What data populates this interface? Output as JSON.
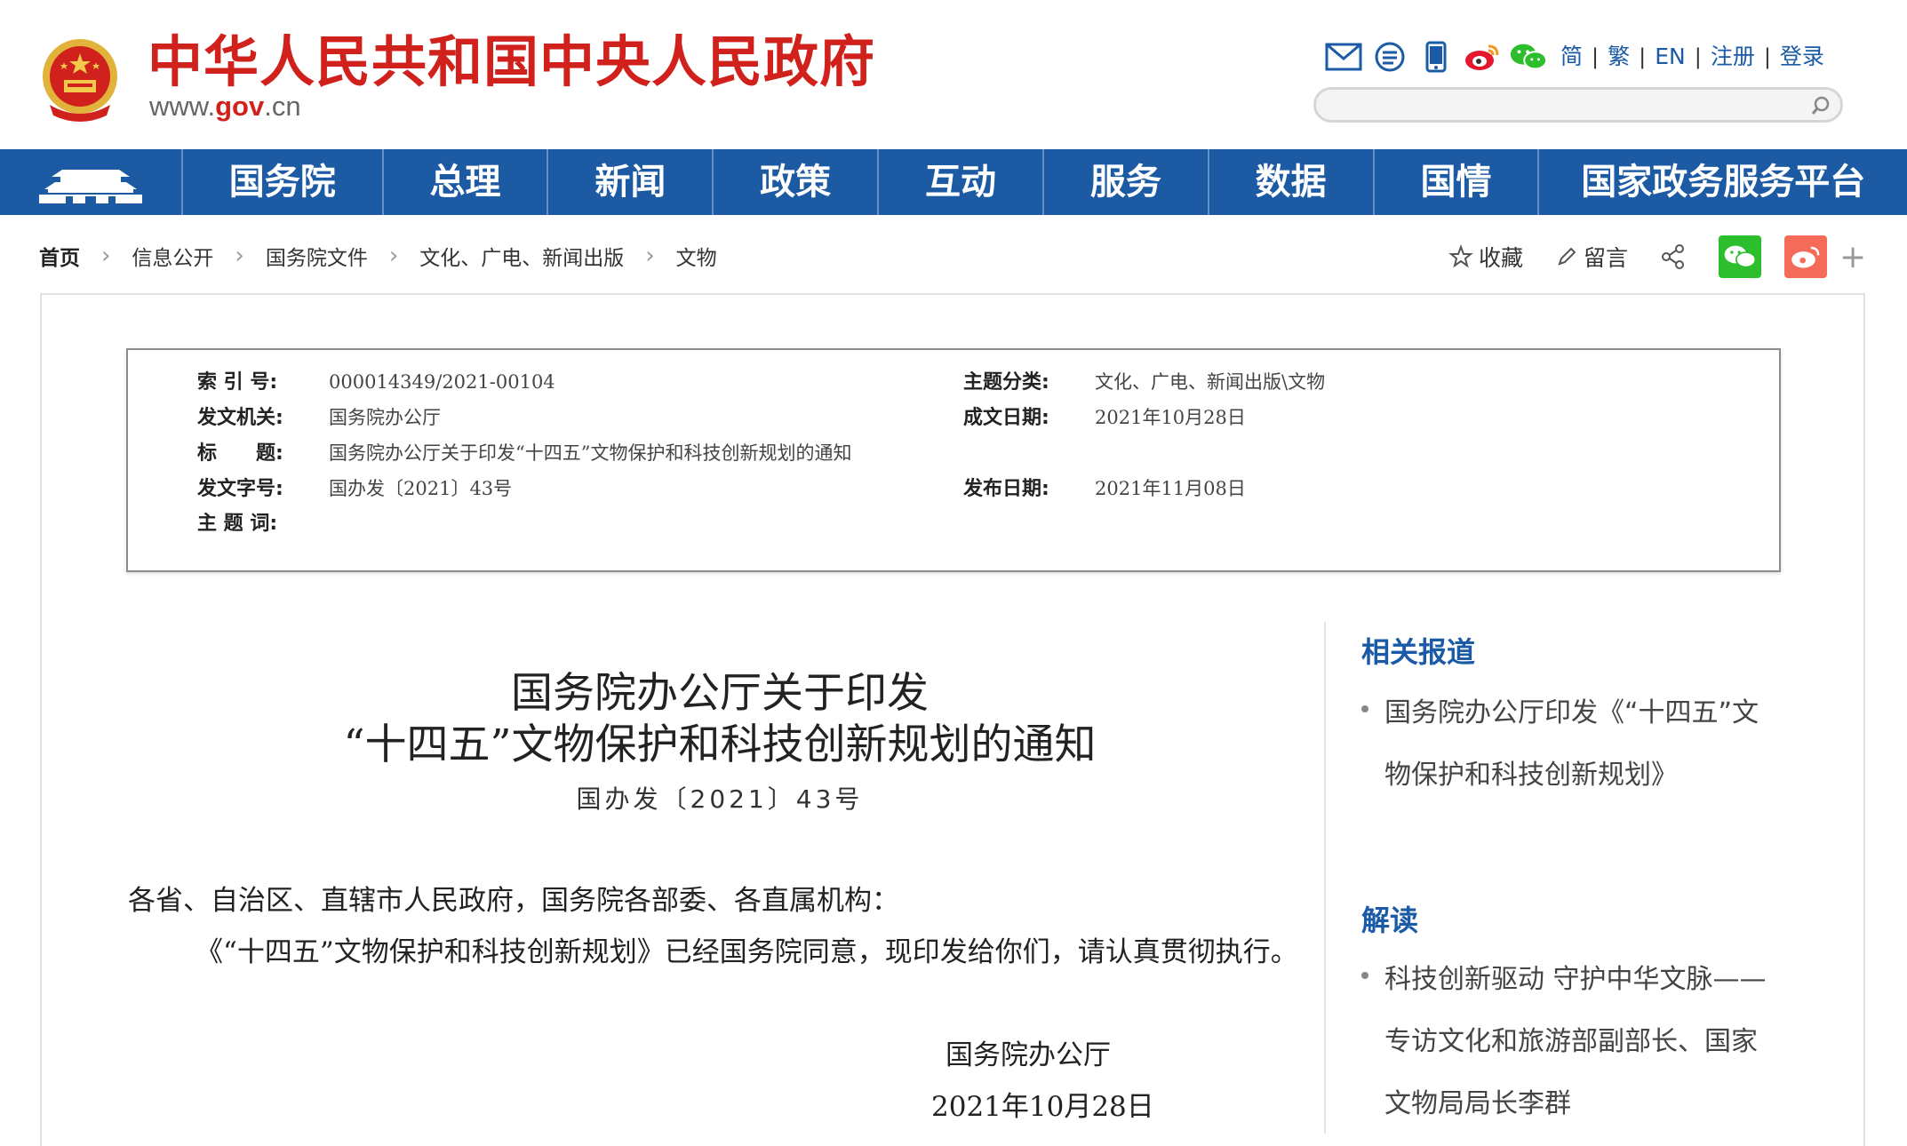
{
  "header": {
    "site_name": "中华人民共和国中央人民政府",
    "site_url_prefix": "www.",
    "site_url_domain": "gov",
    "site_url_suffix": ".cn",
    "links": [
      {
        "label": "简"
      },
      {
        "label": "繁"
      },
      {
        "label": "EN"
      },
      {
        "label": "注册"
      },
      {
        "label": "登录"
      }
    ],
    "search_placeholder": ""
  },
  "nav": {
    "items": [
      {
        "label": "国务院"
      },
      {
        "label": "总理"
      },
      {
        "label": "新闻"
      },
      {
        "label": "政策"
      },
      {
        "label": "互动"
      },
      {
        "label": "服务"
      },
      {
        "label": "数据"
      },
      {
        "label": "国情"
      },
      {
        "label": "国家政务服务平台"
      }
    ]
  },
  "breadcrumb": {
    "items": [
      {
        "label": "首页"
      },
      {
        "label": "信息公开"
      },
      {
        "label": "国务院文件"
      },
      {
        "label": "文化、广电、新闻出版"
      },
      {
        "label": "文物"
      }
    ]
  },
  "actions": {
    "favorite_label": "收藏",
    "comment_label": "留言"
  },
  "meta": {
    "index_label": "索 引 号:",
    "index_value": "000014349/2021-00104",
    "category_label": "主题分类:",
    "category_value": "文化、广电、新闻出版\\文物",
    "issuer_label": "发文机关:",
    "issuer_value": "国务院办公厅",
    "written_date_label": "成文日期:",
    "written_date_value": "2021年10月28日",
    "title_label": "标　　题:",
    "title_value": "国务院办公厅关于印发“十四五”文物保护和科技创新规划的通知",
    "doc_no_label": "发文字号:",
    "doc_no_value": "国办发〔2021〕43号",
    "publish_date_label": "发布日期:",
    "publish_date_value": "2021年11月08日",
    "keywords_label": "主 题 词:",
    "keywords_value": ""
  },
  "article": {
    "title_line1": "国务院办公厅关于印发",
    "title_line2": "“十四五”文物保护和科技创新规划的通知",
    "doc_number": "国办发〔2021〕43号",
    "salutation": "各省、自治区、直辖市人民政府，国务院各部委、各直属机构：",
    "paragraph1": "《“十四五”文物保护和科技创新规划》已经国务院同意，现印发给你们，请认真贯彻执行。",
    "signer": "国务院办公厅",
    "sign_date": "2021年10月28日"
  },
  "sidebar": {
    "related_title": "相关报道",
    "related_items": [
      {
        "text": "国务院办公厅印发《“十四五”文物保护和科技创新规划》"
      }
    ],
    "interpret_title": "解读",
    "interpret_items": [
      {
        "text": "科技创新驱动 守护中华文脉——专访文化和旅游部副部长、国家文物局局长李群"
      }
    ]
  },
  "colors": {
    "brand_red": "#d1211c",
    "nav_blue": "#1c5aa3",
    "link_blue": "#1a5aa6",
    "wechat_green": "#2dbe2d",
    "weibo_red": "#f56b59"
  }
}
